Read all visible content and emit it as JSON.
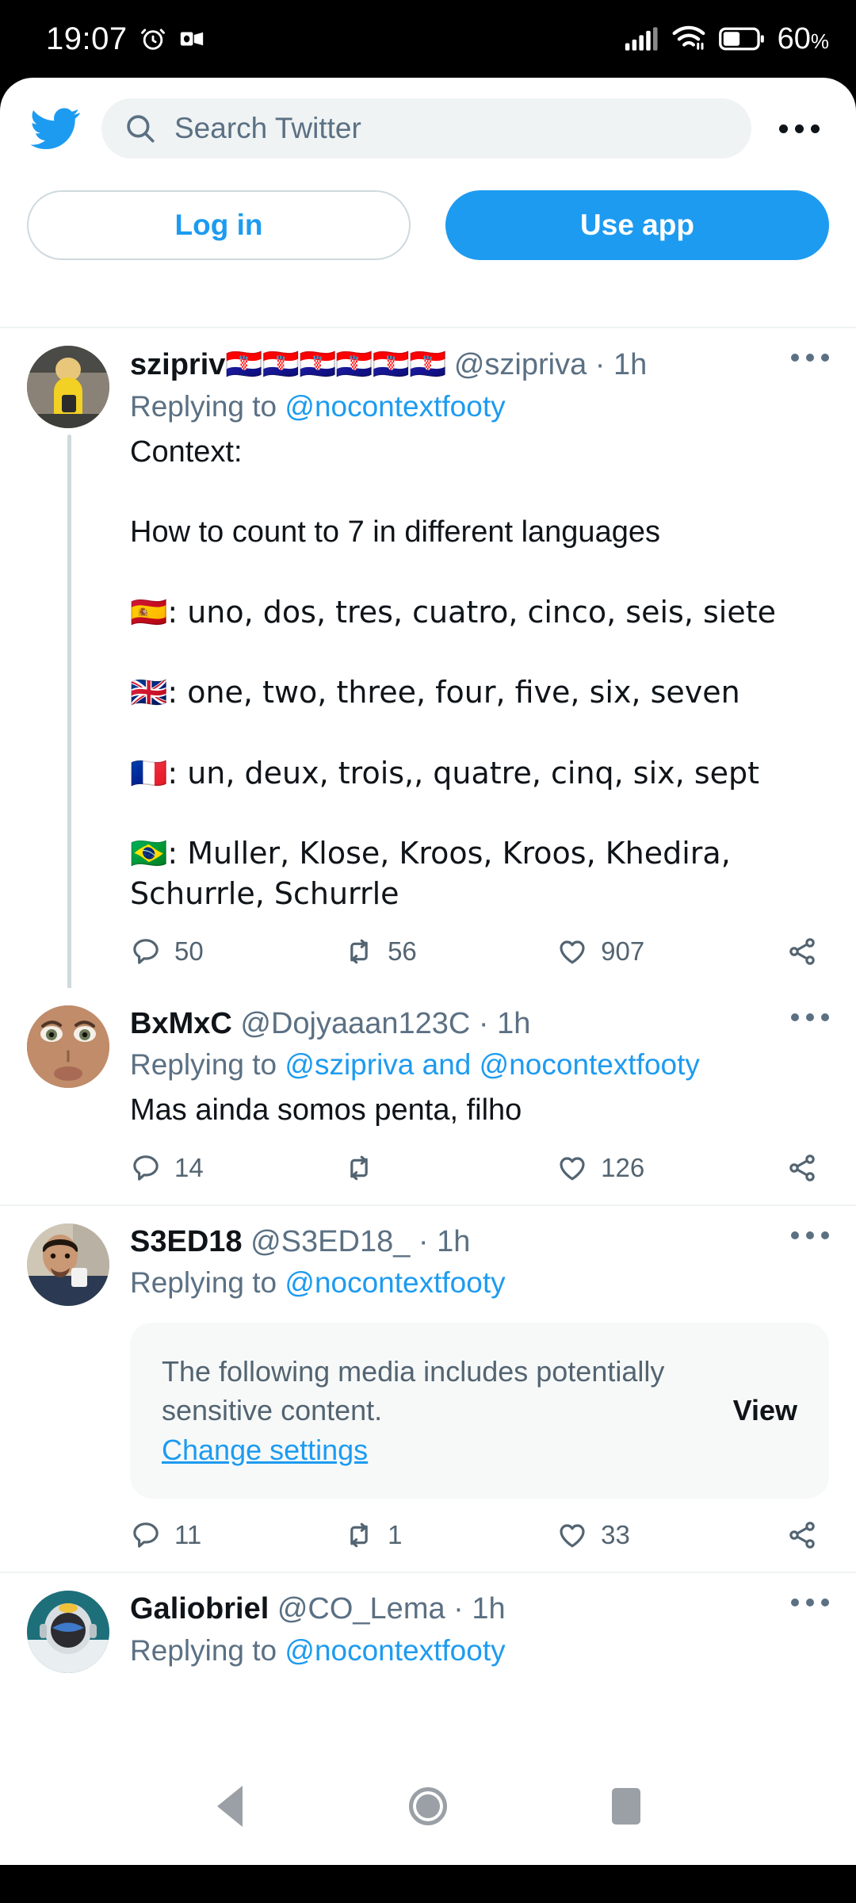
{
  "status_bar": {
    "time": "19:07",
    "alarm_icon": "alarm-clock-icon",
    "app_icon": "outlook-icon",
    "signal_icon": "cellular-signal-icon",
    "wifi_icon": "wifi-icon",
    "battery_icon": "battery-icon",
    "battery_percent": "60",
    "percent_sign": "%"
  },
  "top_bar": {
    "logo": "twitter-bird-logo",
    "search_placeholder": "Search Twitter",
    "search_icon": "search-icon",
    "overflow_icon": "more-options-icon"
  },
  "auth": {
    "login_label": "Log in",
    "use_app_label": "Use app"
  },
  "tweets": [
    {
      "display_name": "szipriv",
      "flags": "🇭🇷🇭🇷🇭🇷🇭🇷🇭🇷🇭🇷",
      "handle": "@szipriva",
      "separator": "·",
      "time": "1h",
      "replying_prefix": "Replying to ",
      "replying_to": "@nocontextfooty",
      "body_lines": [
        "Context:",
        "",
        "How to count to 7 in different languages",
        "",
        "🇪🇸: uno, dos, tres, cuatro, cinco, seis, siete",
        "",
        "🇬🇧: one, two, three, four, five, six, seven",
        "",
        "🇫🇷: un, deux, trois,, quatre, cinq, six, sept",
        "",
        "🇧🇷: Muller, Klose, Kroos, Kroos, Khedira, Schurrle, Schurrle"
      ],
      "reply_count": "50",
      "retweet_count": "56",
      "like_count": "907",
      "has_thread_line": true
    },
    {
      "display_name": "BxMxC",
      "flags": "",
      "handle": "@Dojyaaan123C",
      "separator": "·",
      "time": "1h",
      "replying_prefix": "Replying to ",
      "replying_to": "@szipriva and @nocontextfooty",
      "body_lines": [
        "Mas ainda somos penta, filho"
      ],
      "reply_count": "14",
      "retweet_count": "",
      "like_count": "126",
      "has_thread_line": false
    },
    {
      "display_name": "S3ED18",
      "flags": "",
      "handle": "@S3ED18_",
      "separator": "·",
      "time": "1h",
      "replying_prefix": "Replying to ",
      "replying_to": "@nocontextfooty",
      "body_lines": [],
      "sensitive_notice": {
        "message": "The following media includes potentially sensitive content.",
        "settings_link": "Change settings",
        "view_label": "View"
      },
      "reply_count": "11",
      "retweet_count": "1",
      "like_count": "33",
      "has_thread_line": false
    },
    {
      "display_name": "Galiobriel",
      "flags": "",
      "handle": "@CO_Lema",
      "separator": "·",
      "time": "1h",
      "replying_prefix": "Replying to ",
      "replying_to": "@nocontextfooty",
      "body_lines": [],
      "has_thread_line": false
    }
  ],
  "action_icons": {
    "reply": "reply-icon",
    "retweet": "retweet-icon",
    "like": "like-heart-icon",
    "share": "share-icon"
  },
  "nav_bar": {
    "back": "back-button",
    "home": "home-button",
    "recents": "recents-button"
  },
  "colors": {
    "twitter_blue": "#1d9bf0",
    "text_primary": "#0f1419",
    "text_secondary": "#5b7083",
    "divider": "#eff3f4"
  }
}
